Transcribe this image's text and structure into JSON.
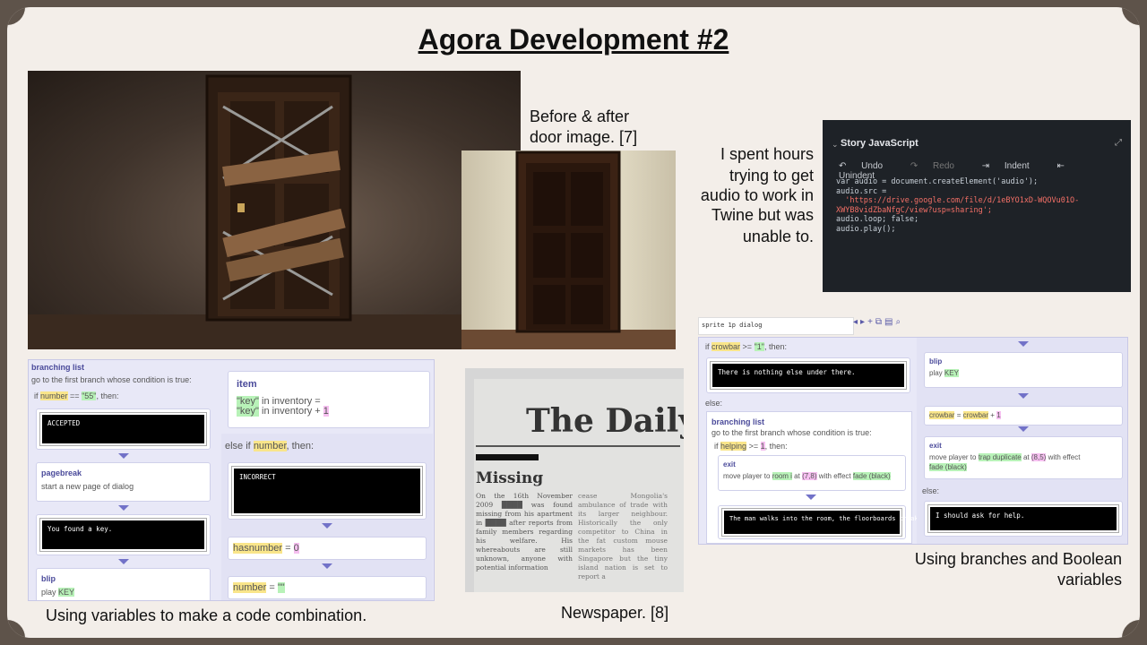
{
  "title": "Agora Development #2",
  "captions": {
    "door_caption_line1": "Before & after",
    "door_caption_line2": "door image. [7]",
    "audio_note_line1": "I spent hours",
    "audio_note_line2": "trying to get",
    "audio_note_line3": "audio to work in",
    "audio_note_line4": "Twine but was",
    "audio_note_line5": "unable to.",
    "variables_caption": "Using variables to make a code combination.",
    "newspaper_caption": "Newspaper. [8]",
    "branches_caption_line1": "Using branches and Boolean",
    "branches_caption_line2": "variables"
  },
  "editor": {
    "title": "Story JavaScript",
    "undo": "Undo",
    "redo": "Redo",
    "indent": "Indent",
    "unindent": "Unindent",
    "code_line1": "var audio = document.createElement('audio');",
    "code_line2": "audio.src =",
    "code_line3": "  'https://drive.google.com/file/d/1eBYO1xD-WQOVu01O-",
    "code_line4": "XWYB8vidZbaNfgC/view?usp=sharing';",
    "code_line5": "audio.loop; false;",
    "code_line6": "audio.play();"
  },
  "left_panel": {
    "branching_title": "branching list",
    "branching_desc": "go to the first branch whose condition is true:",
    "if_prefix": "if",
    "if_var": "number",
    "if_op": "==",
    "if_val": "\"55\"",
    "if_suffix": ", then:",
    "term_accepted": "ACCEPTED",
    "pagebreak_title": "pagebreak",
    "pagebreak_desc": "start a new page of dialog",
    "term_found": "You found a key.",
    "blip_title": "blip",
    "blip_play": "play",
    "blip_key": "KEY",
    "item_title": "item",
    "item_line1_key": "\"key\"",
    "item_line1_rest": "in inventory =",
    "item_line2_key": "\"key\"",
    "item_line2_rest": "in inventory +",
    "item_line2_num": "1",
    "elseif_prefix": "else if",
    "elseif_var": "number",
    "elseif_suffix": ", then:",
    "term_incorrect": "INCORRECT",
    "assign1_var": "hasnumber",
    "assign1_eq": "=",
    "assign1_val": "0",
    "assign2_var": "number",
    "assign2_eq": "=",
    "assign2_val": "\"\""
  },
  "newspaper": {
    "masthead": "The Daily W",
    "headline": "Missing",
    "col1": "On the 16th November 2009 ████ was found missing from his apartment in ████ after reports from family members regarding his welfare. His whereabouts are still unknown, anyone with potential information",
    "col2": "cease Mongolia's ambulance of trade with its larger neighbour. Historically the only competitor to China in the fat custom mouse markets has been Singapore but the tiny island nation is set to report a"
  },
  "right_panel": {
    "toolbar_name": "sprite 1p dialog",
    "if_prefix": "if",
    "if_var": "crowbar",
    "if_op": ">=",
    "if_val": "\"1\"",
    "if_suffix": ", then:",
    "term_nothing": "There is nothing else under there.",
    "else_label": "else:",
    "branching_title": "branching list",
    "branching_desc": "go to the first branch whose condition is true:",
    "if2_prefix": "if",
    "if2_var": "helping",
    "if2_op": ">=",
    "if2_val": "1",
    "if2_suffix": ", then:",
    "exit_title": "exit",
    "exit_desc1": "move player to",
    "exit_room": "room i",
    "exit_at": "at",
    "exit_coords": "(7,8)",
    "exit_effect": "with effect",
    "exit_fade": "fade (black)",
    "term_walks": "The man walks into the room, the floorboards creaking",
    "blip_title": "blip",
    "blip_play": "play",
    "blip_key": "KEY",
    "assign_var": "crowbar",
    "assign_eq": "=",
    "assign_var2": "crowbar",
    "assign_plus": "+",
    "assign_num": "1",
    "exit2_title": "exit",
    "exit2_desc1": "move player to",
    "exit2_room": "trap duplicate",
    "exit2_at": "at",
    "exit2_coords": "(8,5)",
    "exit2_effect": "with effect",
    "exit2_fade": "fade (black)",
    "else2_label": "else:",
    "term_help": "I should ask for help."
  }
}
